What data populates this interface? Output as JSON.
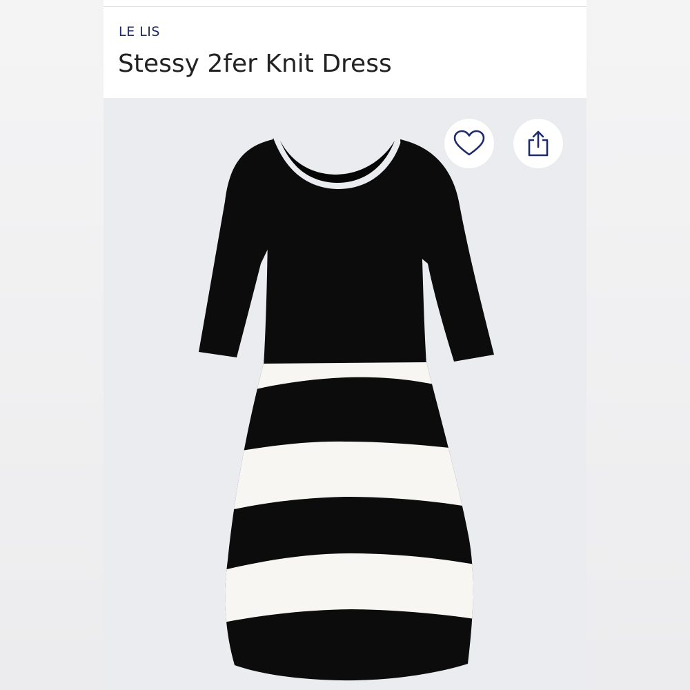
{
  "product": {
    "brand": "LE LIS",
    "name": "Stessy 2fer Knit Dress"
  },
  "image": {
    "subject": "dress-photo",
    "colors": {
      "background": "#ebecef",
      "black_knit": "#0c0c0c",
      "white_knit": "#f7f6f2"
    }
  },
  "actions": {
    "favorite_icon": "heart-outline-icon",
    "share_icon": "share-upload-icon",
    "icon_color": "#1f2a6b"
  },
  "colors": {
    "brand_text": "#1f2a6b",
    "title_text": "#222222"
  }
}
